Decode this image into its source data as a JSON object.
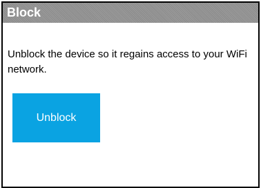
{
  "dialog": {
    "title": "Block",
    "description": "Unblock the device so it regains access to your WiFi network.",
    "unblock_label": "Unblock"
  },
  "colors": {
    "header_bg": "#959595",
    "button_bg": "#0aa3e2",
    "border": "#000000"
  }
}
